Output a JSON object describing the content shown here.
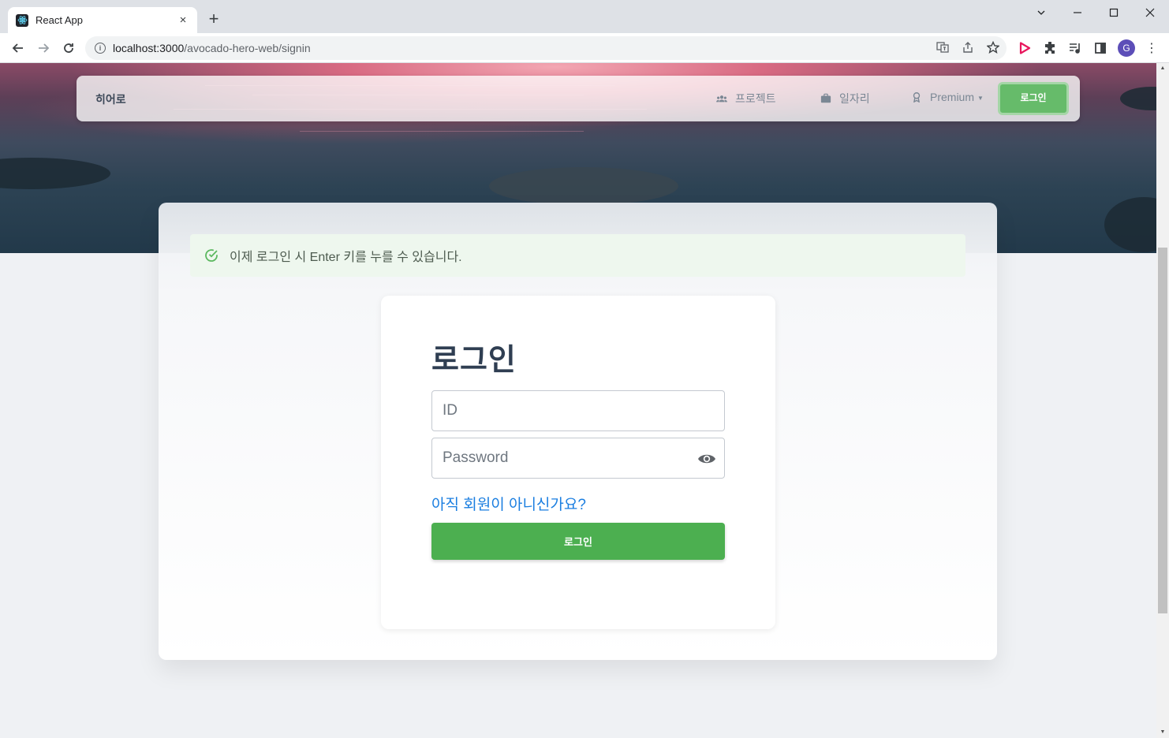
{
  "browser": {
    "tab_title": "React App",
    "tab_close": "×",
    "new_tab": "+",
    "url_host": "localhost:3000",
    "url_path": "/avocado-hero-web/signin",
    "profile_initial": "G",
    "menu": "⋮"
  },
  "navbar": {
    "brand": "히어로",
    "links": [
      {
        "label": "프로젝트",
        "icon": "users-icon"
      },
      {
        "label": "일자리",
        "icon": "briefcase-icon"
      },
      {
        "label": "Premium",
        "icon": "badge-icon"
      }
    ],
    "login_label": "로그인"
  },
  "alert": {
    "text": "이제 로그인 시 Enter 키를 누를 수 있습니다."
  },
  "login": {
    "title": "로그인",
    "id_placeholder": "ID",
    "password_placeholder": "Password",
    "signup_link": "아직 회원이 아니신가요?",
    "submit_label": "로그인"
  },
  "colors": {
    "accent_green": "#4caf50",
    "link_blue": "#1a7ee0",
    "alert_bg": "#eef7ee"
  }
}
